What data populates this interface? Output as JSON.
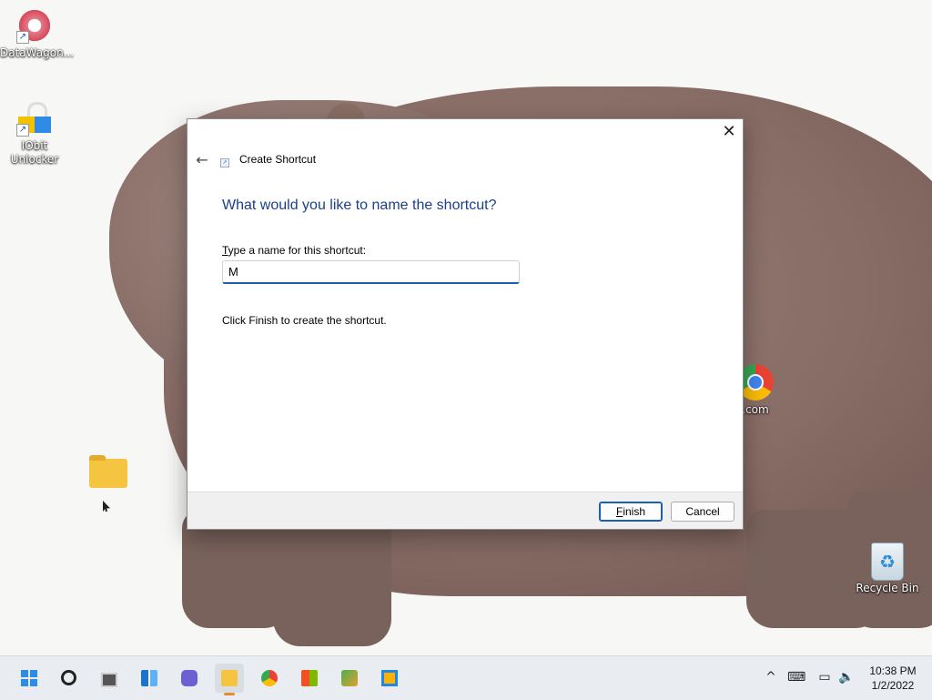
{
  "desktop": {
    "icons": [
      {
        "label": "DataWagon...",
        "icon": "datawagon-icon"
      },
      {
        "label": "IObit Unlocker",
        "icon": "iobit-unlocker-icon"
      },
      {
        "label": "",
        "icon": "folder-icon"
      },
      {
        "label": ".com",
        "icon": "chrome-icon"
      },
      {
        "label": "Recycle Bin",
        "icon": "recycle-bin-icon"
      }
    ]
  },
  "dialog": {
    "title": "Create Shortcut",
    "heading": "What would you like to name the shortcut?",
    "name_label_mnemonic": "T",
    "name_label_rest": "ype a name for this shortcut:",
    "name_value": "M",
    "hint": "Click Finish to create the shortcut.",
    "finish_mnemonic": "F",
    "finish_rest": "inish",
    "cancel_label": "Cancel",
    "close_glyph": "✕",
    "back_glyph": "←",
    "accent_color": "#1a5fb4"
  },
  "taskbar": {
    "items": [
      "Start",
      "Search",
      "Task View",
      "Widgets",
      "Chat",
      "File Explorer",
      "Google Chrome",
      "Microsoft Store",
      "App",
      "App"
    ],
    "tray": {
      "chevron": "^",
      "time": "10:38 PM",
      "date": "1/2/2022"
    }
  }
}
